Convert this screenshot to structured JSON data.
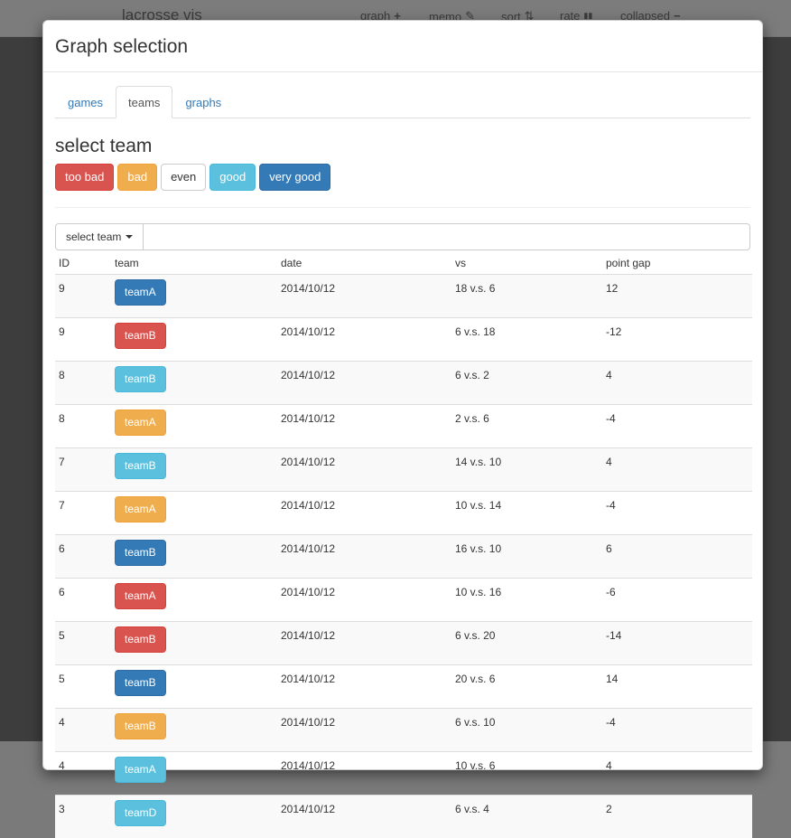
{
  "navbar": {
    "brand": "lacrosse vis",
    "items": [
      {
        "label": "graph",
        "icon": "+"
      },
      {
        "label": "memo",
        "icon": "✎"
      },
      {
        "label": "sort",
        "icon": "⇅"
      },
      {
        "label": "rate",
        "icon": "▮▮"
      },
      {
        "label": "collapsed",
        "icon": "−"
      }
    ]
  },
  "modal": {
    "title": "Graph selection",
    "tabs": [
      {
        "label": "games",
        "active": false
      },
      {
        "label": "teams",
        "active": true
      },
      {
        "label": "graphs",
        "active": false
      }
    ],
    "section_title": "select team",
    "rate_buttons": [
      {
        "label": "too bad",
        "style": "danger"
      },
      {
        "label": "bad",
        "style": "warning"
      },
      {
        "label": "even",
        "style": "default"
      },
      {
        "label": "good",
        "style": "info"
      },
      {
        "label": "very good",
        "style": "primary"
      }
    ],
    "filter": {
      "dropdown_label": "select team",
      "search_value": "",
      "search_placeholder": ""
    },
    "table": {
      "headers": [
        "ID",
        "team",
        "date",
        "vs",
        "point gap"
      ],
      "rows": [
        {
          "id": "9",
          "team": "teamA",
          "style": "primary",
          "date": "2014/10/12",
          "vs": "18 v.s. 6",
          "gap": "12"
        },
        {
          "id": "9",
          "team": "teamB",
          "style": "danger",
          "date": "2014/10/12",
          "vs": "6 v.s. 18",
          "gap": "-12"
        },
        {
          "id": "8",
          "team": "teamB",
          "style": "info",
          "date": "2014/10/12",
          "vs": "6 v.s. 2",
          "gap": "4"
        },
        {
          "id": "8",
          "team": "teamA",
          "style": "warning",
          "date": "2014/10/12",
          "vs": "2 v.s. 6",
          "gap": "-4"
        },
        {
          "id": "7",
          "team": "teamB",
          "style": "info",
          "date": "2014/10/12",
          "vs": "14 v.s. 10",
          "gap": "4"
        },
        {
          "id": "7",
          "team": "teamA",
          "style": "warning",
          "date": "2014/10/12",
          "vs": "10 v.s. 14",
          "gap": "-4"
        },
        {
          "id": "6",
          "team": "teamB",
          "style": "primary",
          "date": "2014/10/12",
          "vs": "16 v.s. 10",
          "gap": "6"
        },
        {
          "id": "6",
          "team": "teamA",
          "style": "danger",
          "date": "2014/10/12",
          "vs": "10 v.s. 16",
          "gap": "-6"
        },
        {
          "id": "5",
          "team": "teamB",
          "style": "danger",
          "date": "2014/10/12",
          "vs": "6 v.s. 20",
          "gap": "-14"
        },
        {
          "id": "5",
          "team": "teamB",
          "style": "primary",
          "date": "2014/10/12",
          "vs": "20 v.s. 6",
          "gap": "14"
        },
        {
          "id": "4",
          "team": "teamB",
          "style": "warning",
          "date": "2014/10/12",
          "vs": "6 v.s. 10",
          "gap": "-4"
        },
        {
          "id": "4",
          "team": "teamA",
          "style": "info",
          "date": "2014/10/12",
          "vs": "10 v.s. 6",
          "gap": "4"
        },
        {
          "id": "3",
          "team": "teamD",
          "style": "info",
          "date": "2014/10/12",
          "vs": "6 v.s. 4",
          "gap": "2"
        }
      ]
    }
  }
}
